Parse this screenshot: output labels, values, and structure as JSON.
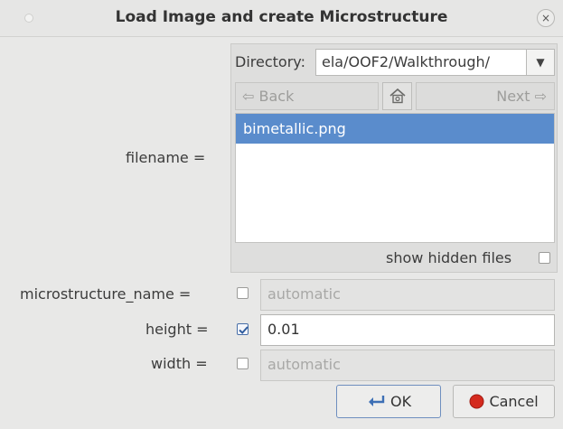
{
  "window": {
    "title": "Load Image and create Microstructure",
    "close_icon": "×"
  },
  "chooser": {
    "directory_label": "Directory:",
    "directory_value": "ela/OOF2/Walkthrough/",
    "back_label": "Back",
    "next_label": "Next",
    "files": [
      "bimetallic.png"
    ],
    "selected_file": "bimetallic.png",
    "show_hidden_label": "show hidden files",
    "show_hidden_checked": false
  },
  "form": {
    "filename_label": "filename =",
    "microstructure_name_label": "microstructure_name =",
    "microstructure_name_placeholder": "automatic",
    "microstructure_name_checked": false,
    "height_label": "height =",
    "height_value": "0.01",
    "height_checked": true,
    "width_label": "width =",
    "width_placeholder": "automatic",
    "width_checked": false
  },
  "buttons": {
    "ok_label": "OK",
    "cancel_label": "Cancel"
  },
  "colors": {
    "selection": "#5a8ccc",
    "cancel_icon": "#d42a1e"
  }
}
